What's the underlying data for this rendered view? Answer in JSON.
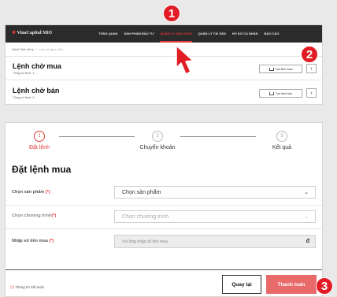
{
  "navbar": {
    "logo_mark": "✖",
    "logo_text": "VinaCapital MiO",
    "items": [
      {
        "label": "TỔNG QUAN",
        "active": false
      },
      {
        "label": "SẢN PHẨM ĐẦU TƯ",
        "active": false
      },
      {
        "label": "QUẢN LÝ GIAO DỊCH",
        "active": true
      },
      {
        "label": "QUẢN LÝ TÀI SẢN",
        "active": false
      },
      {
        "label": "HỒ SƠ CÁ NHÂN",
        "active": false
      },
      {
        "label": "BÁO CÁO",
        "active": false
      }
    ]
  },
  "breadcrumb": {
    "current": "Lệnh Chờ xử lý",
    "sub": "Lịch sử giao dịch"
  },
  "orders": [
    {
      "title": "Lệnh chờ mua",
      "count": "Tổng số lệnh: 1",
      "button": "Tạo lệnh mua"
    },
    {
      "title": "Lệnh chờ bán",
      "count": "Tổng số lệnh: 0",
      "button": "Tạo lệnh bán"
    }
  ],
  "steps": [
    {
      "num": "1",
      "label": "Đặt lệnh",
      "active": true
    },
    {
      "num": "2",
      "label": "Chuyển khoản",
      "active": false
    },
    {
      "num": "3",
      "label": "Kết quả",
      "active": false
    }
  ],
  "form": {
    "title": "Đặt lệnh mua",
    "product_label": "Chọn sản phẩm",
    "product_value": "Chọn sản phẩm",
    "program_label": "Chọn chương trình",
    "program_value": "Chọn chương trình",
    "amount_label": "Nhập số tiền mua",
    "amount_placeholder": "Vui lòng nhập số tiền mua",
    "currency": "đ",
    "required_mark": "(*)"
  },
  "footer": {
    "note_mark": "(*)",
    "note_text": "Thông tin bắt buộc",
    "back_label": "Quay lại",
    "pay_label": "Thanh toán"
  },
  "annotations": [
    "1",
    "2",
    "3"
  ],
  "colors": {
    "accent": "#e23a3a",
    "marker": "#e11c24",
    "pay_button": "#e86a6a",
    "navbar": "#2b2b2b"
  }
}
